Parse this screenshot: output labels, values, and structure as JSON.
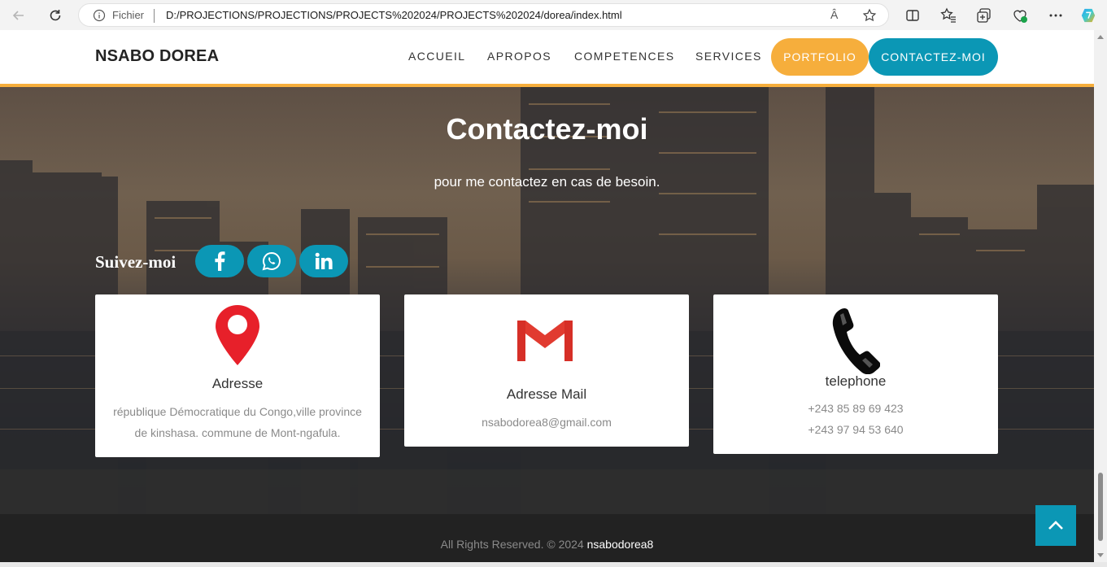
{
  "browser": {
    "protocol_label": "Fichier",
    "url": "D:/PROJECTIONS/PROJECTIONS/PROJECTS%202024/PROJECTS%202024/dorea/index.html",
    "read_aloud": "Â"
  },
  "header": {
    "brand": "NSABO DOREA",
    "menu": [
      "ACCUEIL",
      "APROPOS",
      "COMPETENCES",
      "SERVICES"
    ],
    "portfolio": "PORTFOLIO",
    "contact": "CONTACTEZ-MOI",
    "colors": {
      "accent_orange": "#f6ae3c",
      "accent_teal": "#0b97b5"
    }
  },
  "contact_section": {
    "title": "Contactez-moi",
    "subtitle": "pour me contactez en cas de besoin.",
    "follow_label": "Suivez-moi",
    "socials": [
      "facebook-icon",
      "whatsapp-icon",
      "linkedin-icon"
    ]
  },
  "cards": {
    "address": {
      "icon": "map-pin-icon",
      "title": "Adresse",
      "line1": "république Démocratique du Congo,ville province",
      "line2": "de kinshasa. commune de Mont-ngafula."
    },
    "mail": {
      "icon": "gmail-icon",
      "title": "Adresse Mail",
      "line1": "nsabodorea8@gmail.com"
    },
    "phone": {
      "icon": "phone-icon",
      "title": "telephone",
      "line1": "+243 85 89 69 423",
      "line2": "+243 97 94 53 640"
    }
  },
  "footer": {
    "rights": "All Rights Reserved. © 2024",
    "owner": "nsabodorea8"
  }
}
